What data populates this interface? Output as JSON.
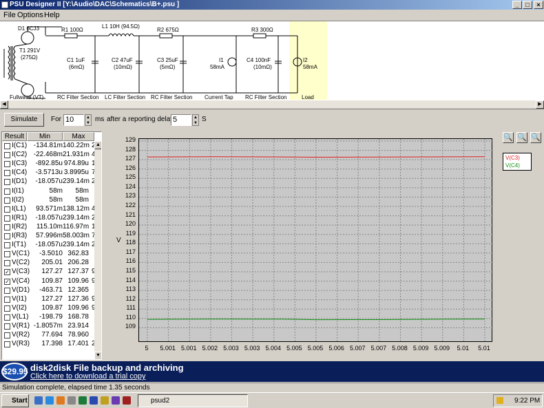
{
  "window": {
    "title": "PSU Designer II  [Y:\\Audio\\DAC\\Schematics\\B+.psu ]",
    "btn_min": "_",
    "btn_max": "□",
    "btn_close": "×"
  },
  "menu": [
    "File",
    "Options",
    "Help"
  ],
  "schematic": {
    "d1": "D1 6CJ3",
    "t1": "T1 291V",
    "t1_r": "(275Ω)",
    "r1": "R1 100Ω",
    "l1": "L1 10H (94.5Ω)",
    "r2": "R2 675Ω",
    "r3": "R3 300Ω",
    "c1": "C1 1uF",
    "c1_r": "(6mΩ)",
    "c2": "C2 47uF",
    "c2_r": "(10mΩ)",
    "c3": "C3 25uF",
    "c3_r": "(5mΩ)",
    "i1": "I1",
    "i1_v": "58mA",
    "c4": "C4 100nF",
    "c4_r": "(10mΩ)",
    "i2": "I2",
    "i2_v": "58mA",
    "sections": [
      "Fullwave (VT)",
      "RC Filter Section",
      "LC Filter Section",
      "RC Filter Section",
      "Current Tap",
      "RC Filter Section",
      "Load"
    ]
  },
  "sim": {
    "simulate_label": "Simulate",
    "for_label": "For",
    "duration": "10",
    "ms_label": "ms",
    "delay_label": "after a reporting delay of",
    "delay": "5",
    "s_label": "S"
  },
  "results": {
    "headers": [
      "Result",
      "Min",
      "Max"
    ],
    "rows": [
      {
        "name": "I(C1)",
        "min": "-134.81m",
        "max": "140.22m",
        "extra": "2",
        "checked": false
      },
      {
        "name": "I(C2)",
        "min": "-22.468m",
        "max": "21.931m",
        "extra": "4",
        "checked": false
      },
      {
        "name": "I(C3)",
        "min": "-892.85u",
        "max": "974.89u",
        "extra": "1",
        "checked": false
      },
      {
        "name": "I(C4)",
        "min": "-3.5713u",
        "max": "3.8995u",
        "extra": "7",
        "checked": false
      },
      {
        "name": "I(D1)",
        "min": "-18.057u",
        "max": "239.14m",
        "extra": "2",
        "checked": false
      },
      {
        "name": "I(I1)",
        "min": "58m",
        "max": "58m",
        "extra": "",
        "checked": false
      },
      {
        "name": "I(I2)",
        "min": "58m",
        "max": "58m",
        "extra": "",
        "checked": false
      },
      {
        "name": "I(L1)",
        "min": "93.571m",
        "max": "138.12m",
        "extra": "4",
        "checked": false
      },
      {
        "name": "I(R1)",
        "min": "-18.057u",
        "max": "239.14m",
        "extra": "2",
        "checked": false
      },
      {
        "name": "I(R2)",
        "min": "115.10m",
        "max": "116.97m",
        "extra": "1",
        "checked": false
      },
      {
        "name": "I(R3)",
        "min": "57.996m",
        "max": "58.003m",
        "extra": "7",
        "checked": false
      },
      {
        "name": "I(T1)",
        "min": "-18.057u",
        "max": "239.14m",
        "extra": "2",
        "checked": false
      },
      {
        "name": "V(C1)",
        "min": "-3.5010",
        "max": "362.83",
        "extra": "",
        "checked": false
      },
      {
        "name": "V(C2)",
        "min": "205.01",
        "max": "206.28",
        "extra": "",
        "checked": false
      },
      {
        "name": "V(C3)",
        "min": "127.27",
        "max": "127.37",
        "extra": "9",
        "checked": true
      },
      {
        "name": "V(C4)",
        "min": "109.87",
        "max": "109.96",
        "extra": "9",
        "checked": true
      },
      {
        "name": "V(D1)",
        "min": "-463.71",
        "max": "12.365",
        "extra": "",
        "checked": false
      },
      {
        "name": "V(I1)",
        "min": "127.27",
        "max": "127.36",
        "extra": "9",
        "checked": false
      },
      {
        "name": "V(I2)",
        "min": "109.87",
        "max": "109.96",
        "extra": "9",
        "checked": false
      },
      {
        "name": "V(L1)",
        "min": "-198.79",
        "max": "168.78",
        "extra": "",
        "checked": false
      },
      {
        "name": "V(R1)",
        "min": "-1.8057m",
        "max": "23.914",
        "extra": "",
        "checked": false
      },
      {
        "name": "V(R2)",
        "min": "77.694",
        "max": "78.960",
        "extra": "",
        "checked": false
      },
      {
        "name": "V(R3)",
        "min": "17.398",
        "max": "17.401",
        "extra": "2",
        "checked": false
      }
    ]
  },
  "chart_data": {
    "type": "line",
    "ylabel": "V",
    "xlim": [
      5,
      5.01
    ],
    "ylim": [
      108,
      129
    ],
    "y_ticks": [
      "129",
      "128",
      "127",
      "126",
      "125",
      "124",
      "123",
      "122",
      "121",
      "120",
      "119",
      "118",
      "117",
      "116",
      "115",
      "114",
      "113",
      "112",
      "111",
      "110",
      "109"
    ],
    "x_ticks": [
      "5",
      "5.001",
      "5.001",
      "5.002",
      "5.003",
      "5.003",
      "5.004",
      "5.005",
      "5.005",
      "5.006",
      "5.007",
      "5.007",
      "5.008",
      "5.009",
      "5.009",
      "5.01",
      "5.01"
    ],
    "grid": true,
    "legend_position": "top-right",
    "series": [
      {
        "name": "V(C3)",
        "color": "#e02020",
        "x": [
          5,
          5.002,
          5.004,
          5.005,
          5.007,
          5.009,
          5.01
        ],
        "y": [
          127.3,
          127.32,
          127.3,
          127.27,
          127.28,
          127.31,
          127.32
        ]
      },
      {
        "name": "V(C4)",
        "color": "#109010",
        "x": [
          5,
          5.002,
          5.004,
          5.005,
          5.007,
          5.009,
          5.01
        ],
        "y": [
          109.9,
          109.93,
          109.92,
          109.87,
          109.88,
          109.92,
          109.93
        ]
      }
    ]
  },
  "banner": {
    "price": "$29.95",
    "title": "disk2disk File backup and archiving",
    "link": "Click here to download a trial copy"
  },
  "status": "Simulation complete, elapsed time 1.35 seconds",
  "taskbar": {
    "start": "Start",
    "task": "psud2",
    "clock": "9:22 PM"
  }
}
